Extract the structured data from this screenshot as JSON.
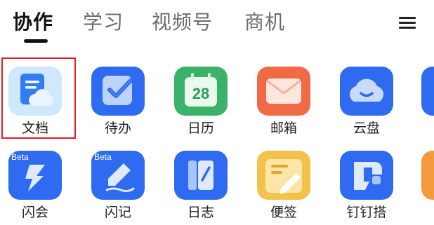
{
  "tabs": [
    {
      "label": "协作",
      "active": true
    },
    {
      "label": "学习",
      "active": false
    },
    {
      "label": "视频号",
      "active": false
    },
    {
      "label": "商机",
      "active": false
    }
  ],
  "menu_icon": "hamburger-menu-icon",
  "apps_row1": [
    {
      "label": "文档",
      "icon": "document-icon",
      "selected": true
    },
    {
      "label": "待办",
      "icon": "todo-check-icon"
    },
    {
      "label": "日历",
      "icon": "calendar-icon",
      "day": "28"
    },
    {
      "label": "邮箱",
      "icon": "mail-icon"
    },
    {
      "label": "云盘",
      "icon": "cloud-drive-icon"
    }
  ],
  "apps_row2": [
    {
      "label": "闪会",
      "icon": "flash-meeting-icon",
      "badge": "Beta"
    },
    {
      "label": "闪记",
      "icon": "flash-note-icon",
      "badge": "Beta"
    },
    {
      "label": "日志",
      "icon": "log-journal-icon"
    },
    {
      "label": "便签",
      "icon": "sticky-note-icon"
    },
    {
      "label": "钉钉搭",
      "icon": "dingtalk-builder-icon"
    }
  ],
  "colors": {
    "selection": "#e02020",
    "blue": "#2f6bf0",
    "green": "#3bb26a",
    "orange": "#ef6a45",
    "yellow": "#f4c24a"
  }
}
